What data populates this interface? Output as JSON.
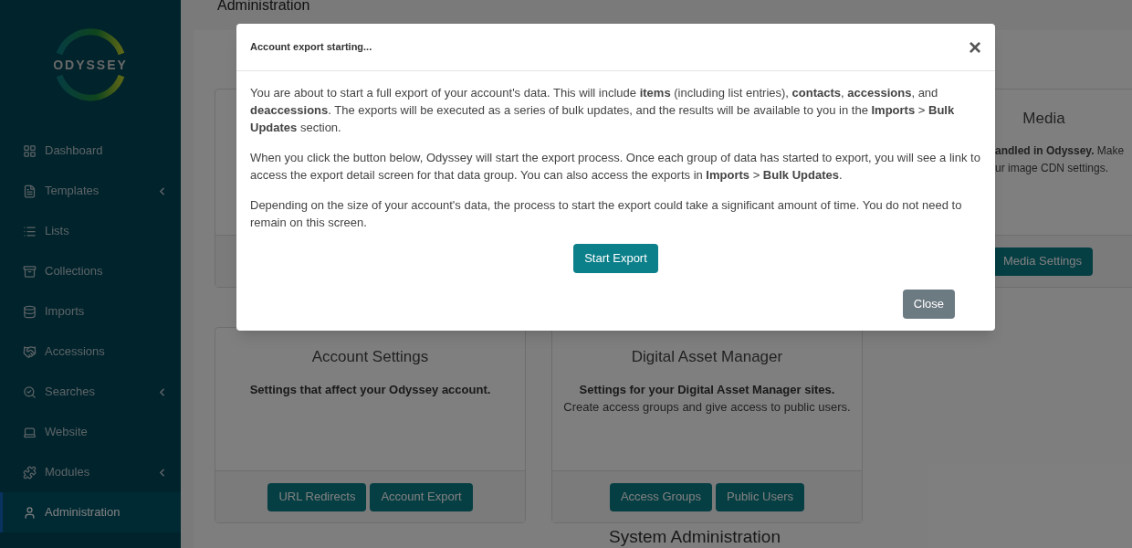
{
  "sidebar": {
    "logo": "ODYSSEY",
    "items": [
      {
        "label": "Dashboard",
        "kind": "grid",
        "has_submenu": false,
        "selected": false
      },
      {
        "label": "Templates",
        "kind": "file",
        "has_submenu": true,
        "selected": false
      },
      {
        "label": "Lists",
        "kind": "list",
        "has_submenu": false,
        "selected": false
      },
      {
        "label": "Collections",
        "kind": "archive",
        "has_submenu": false,
        "selected": false
      },
      {
        "label": "Imports",
        "kind": "database",
        "has_submenu": false,
        "selected": false
      },
      {
        "label": "Accessions",
        "kind": "handshake",
        "has_submenu": false,
        "selected": false
      },
      {
        "label": "Searches",
        "kind": "search",
        "has_submenu": true,
        "selected": false
      },
      {
        "label": "Website",
        "kind": "laptop",
        "has_submenu": false,
        "selected": false
      },
      {
        "label": "Modules",
        "kind": "puzzle",
        "has_submenu": true,
        "selected": false
      },
      {
        "label": "Administration",
        "kind": "user",
        "has_submenu": false,
        "selected": true
      }
    ]
  },
  "page": {
    "title": "Administration",
    "media_card": {
      "title": "Media",
      "lines": [
        "**andled in Odyssey.** Make",
        "ur image CDN settings."
      ],
      "buttons": [
        "Media Settings"
      ]
    },
    "cards": [
      {
        "title": "Account Settings",
        "description": "Settings that affect your Odyssey account.",
        "buttons": [
          "URL Redirects",
          "Account Export"
        ]
      },
      {
        "title": "Digital Asset Manager",
        "description": "Settings for your Digital Asset Manager sites.",
        "note": "Create access groups and give access to public users.",
        "buttons": [
          "Access Groups",
          "Public Users"
        ]
      }
    ],
    "section_heading": "System Administration"
  },
  "modal": {
    "title": "Account export starting...",
    "close_symbol": "×",
    "paragraphs": [
      "You are about to start a full export of your account's data. This will include **items** (including list entries), **contacts**, **accessions**, and **deaccessions**. The exports will be executed as a series of bulk updates, and the results will be available to you in the **Imports** > **Bulk Updates** section.",
      "When you click the button below, Odyssey will start the export process. Once each group of data has started to export, you will see a link to access the export detail screen for that data group. You can also access the exports in **Imports** > **Bulk Updates**.",
      "Depending on the size of your account's data, the process to start the export could take a significant amount of time. You do not need to remain on this screen."
    ],
    "primary_button": "Start Export",
    "close_button": "Close"
  }
}
